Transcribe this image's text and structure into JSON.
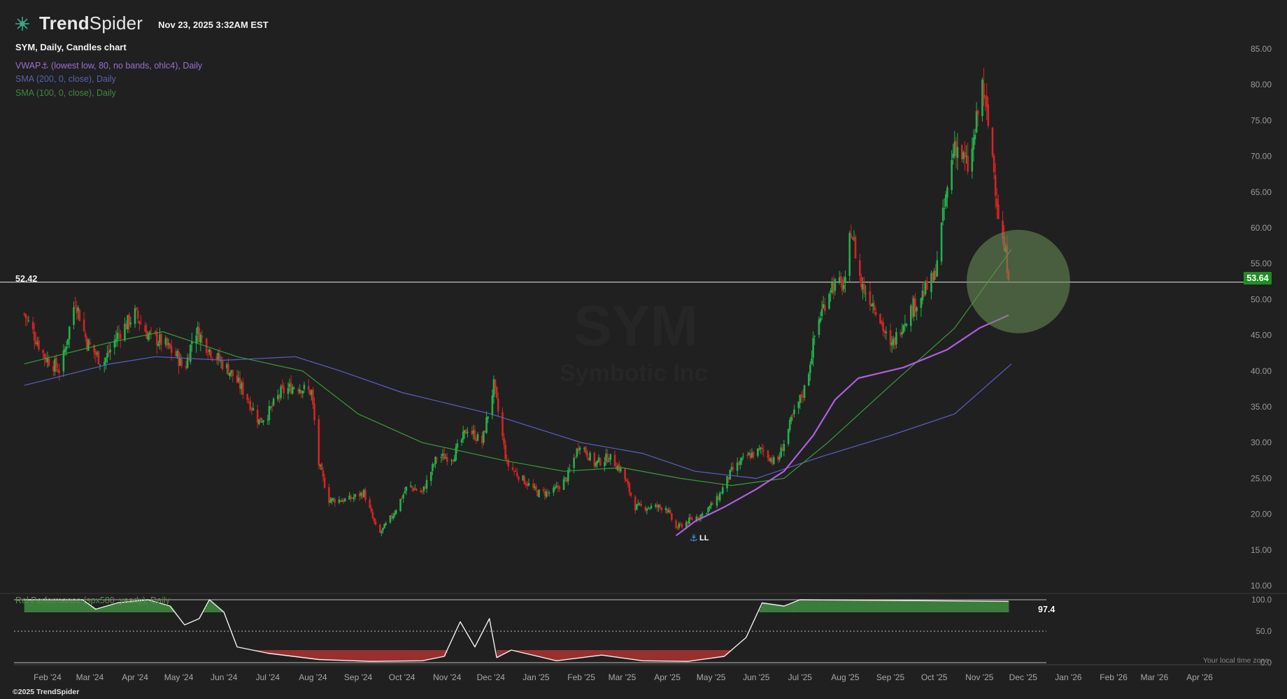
{
  "header": {
    "brand_prefix": "Trend",
    "brand_suffix": "Spider",
    "timestamp": "Nov 23, 2025 3:32AM EST",
    "chart_title": "SYM, Daily, Candles chart",
    "watermark_symbol": "SYM",
    "watermark_name": "Symbotic Inc"
  },
  "indicators": {
    "vwap": "VWAP⚓ (lowest low, 80, no bands, ohlc4), Daily",
    "sma200": "SMA (200, 0, close), Daily",
    "sma100": "SMA (100, 0, close), Daily",
    "relperf": "Rel Performance (spx500, yearly), Daily",
    "relperf_value": "97.4",
    "anchor_label": "LL"
  },
  "levels": {
    "horizontal_level": "52.42",
    "last_price": "53.64"
  },
  "footer": {
    "local_time": "Your local time zone",
    "copyright": "©2025 TrendSpider"
  },
  "colors": {
    "background": "#202020",
    "up": "#22b14c",
    "down": "#d32424",
    "vwap": "#b05ee0",
    "sma200": "#5b5fc7",
    "sma100": "#3a9a3a",
    "highlight_circle": "#6b8f5a"
  },
  "chart_data": {
    "type": "candlestick",
    "price_axis": {
      "ticks": [
        "85.00",
        "80.00",
        "75.00",
        "70.00",
        "65.00",
        "60.00",
        "55.00",
        "50.00",
        "45.00",
        "40.00",
        "35.00",
        "30.00",
        "25.00",
        "20.00",
        "15.00",
        "10.00"
      ],
      "range": [
        10,
        85
      ]
    },
    "x_axis": {
      "labels": [
        "Feb '24",
        "Mar '24",
        "Apr '24",
        "May '24",
        "Jun '24",
        "Jul '24",
        "Aug '24",
        "Sep '24",
        "Oct '24",
        "Nov '24",
        "Dec '24",
        "Jan '25",
        "Feb '25",
        "Mar '25",
        "Apr '25",
        "May '25",
        "Jun '25",
        "Jul '25",
        "Aug '25",
        "Sep '25",
        "Oct '25",
        "Nov '25",
        "Dec '25",
        "Jan '26",
        "Feb '26",
        "Mar '26",
        "Apr '26"
      ]
    },
    "price_path": [
      [
        "2024-01-16",
        48
      ],
      [
        "2024-01-30",
        42
      ],
      [
        "2024-02-10",
        40
      ],
      [
        "2024-02-20",
        50
      ],
      [
        "2024-02-28",
        44
      ],
      [
        "2024-03-10",
        41
      ],
      [
        "2024-03-20",
        45
      ],
      [
        "2024-04-01",
        48
      ],
      [
        "2024-04-10",
        45
      ],
      [
        "2024-04-20",
        44
      ],
      [
        "2024-04-30",
        42
      ],
      [
        "2024-05-05",
        40
      ],
      [
        "2024-05-12",
        46
      ],
      [
        "2024-05-22",
        43
      ],
      [
        "2024-06-05",
        40
      ],
      [
        "2024-06-15",
        37
      ],
      [
        "2024-06-25",
        33
      ],
      [
        "2024-07-01",
        34
      ],
      [
        "2024-07-10",
        37
      ],
      [
        "2024-07-20",
        38
      ],
      [
        "2024-07-31",
        37
      ],
      [
        "2024-08-05",
        27
      ],
      [
        "2024-08-12",
        22
      ],
      [
        "2024-08-25",
        22
      ],
      [
        "2024-09-05",
        23
      ],
      [
        "2024-09-15",
        17
      ],
      [
        "2024-09-25",
        20
      ],
      [
        "2024-10-05",
        24
      ],
      [
        "2024-10-15",
        23
      ],
      [
        "2024-10-25",
        28
      ],
      [
        "2024-11-05",
        28
      ],
      [
        "2024-11-15",
        32
      ],
      [
        "2024-11-25",
        30
      ],
      [
        "2024-12-03",
        38
      ],
      [
        "2024-12-12",
        27
      ],
      [
        "2024-12-22",
        25
      ],
      [
        "2025-01-02",
        23
      ],
      [
        "2025-01-12",
        23
      ],
      [
        "2025-01-22",
        25
      ],
      [
        "2025-01-31",
        30
      ],
      [
        "2025-02-10",
        27
      ],
      [
        "2025-02-20",
        28
      ],
      [
        "2025-03-01",
        26
      ],
      [
        "2025-03-10",
        21
      ],
      [
        "2025-03-20",
        21
      ],
      [
        "2025-03-31",
        21
      ],
      [
        "2025-04-07",
        18
      ],
      [
        "2025-04-15",
        19
      ],
      [
        "2025-04-25",
        20
      ],
      [
        "2025-05-05",
        22
      ],
      [
        "2025-05-15",
        26
      ],
      [
        "2025-05-25",
        28
      ],
      [
        "2025-06-05",
        29
      ],
      [
        "2025-06-15",
        27
      ],
      [
        "2025-06-25",
        33
      ],
      [
        "2025-07-05",
        38
      ],
      [
        "2025-07-12",
        46
      ],
      [
        "2025-07-22",
        52
      ],
      [
        "2025-08-01",
        52
      ],
      [
        "2025-08-05",
        60
      ],
      [
        "2025-08-12",
        52
      ],
      [
        "2025-08-22",
        49
      ],
      [
        "2025-09-01",
        43
      ],
      [
        "2025-09-10",
        47
      ],
      [
        "2025-09-20",
        50
      ],
      [
        "2025-10-01",
        53
      ],
      [
        "2025-10-06",
        60
      ],
      [
        "2025-10-15",
        72
      ],
      [
        "2025-10-25",
        68
      ],
      [
        "2025-11-03",
        80
      ],
      [
        "2025-11-10",
        70
      ],
      [
        "2025-11-15",
        60
      ],
      [
        "2025-11-21",
        54
      ]
    ],
    "sma200_path": [
      [
        "2024-01-16",
        38
      ],
      [
        "2024-03-15",
        41
      ],
      [
        "2024-04-15",
        42
      ],
      [
        "2024-06-01",
        41.5
      ],
      [
        "2024-07-20",
        42
      ],
      [
        "2024-08-20",
        40
      ],
      [
        "2024-10-01",
        37
      ],
      [
        "2024-12-01",
        34
      ],
      [
        "2025-02-01",
        30
      ],
      [
        "2025-03-15",
        28.5
      ],
      [
        "2025-04-20",
        26
      ],
      [
        "2025-06-01",
        25
      ],
      [
        "2025-07-15",
        28
      ],
      [
        "2025-09-01",
        31
      ],
      [
        "2025-10-15",
        34
      ],
      [
        "2025-11-23",
        41
      ]
    ],
    "sma100_path": [
      [
        "2024-01-16",
        41
      ],
      [
        "2024-03-15",
        44
      ],
      [
        "2024-04-20",
        45.5
      ],
      [
        "2024-06-10",
        42
      ],
      [
        "2024-07-25",
        40
      ],
      [
        "2024-09-01",
        34
      ],
      [
        "2024-10-15",
        30
      ],
      [
        "2024-12-10",
        27.5
      ],
      [
        "2025-01-20",
        26
      ],
      [
        "2025-03-01",
        26.5
      ],
      [
        "2025-04-10",
        25
      ],
      [
        "2025-05-15",
        24
      ],
      [
        "2025-06-20",
        25
      ],
      [
        "2025-07-20",
        30
      ],
      [
        "2025-09-01",
        38
      ],
      [
        "2025-10-15",
        46
      ],
      [
        "2025-11-23",
        57
      ]
    ],
    "vwap_path": [
      [
        "2025-04-07",
        17
      ],
      [
        "2025-04-20",
        19
      ],
      [
        "2025-05-10",
        21
      ],
      [
        "2025-06-01",
        23.5
      ],
      [
        "2025-06-20",
        26
      ],
      [
        "2025-07-10",
        31
      ],
      [
        "2025-07-25",
        36
      ],
      [
        "2025-08-10",
        39
      ],
      [
        "2025-09-10",
        40.5
      ],
      [
        "2025-10-10",
        43
      ],
      [
        "2025-11-01",
        46
      ],
      [
        "2025-11-21",
        47.8
      ]
    ],
    "relperf": {
      "ticks": [
        "100.0",
        "50.0",
        "0.0"
      ],
      "range": [
        0,
        100
      ],
      "path": [
        [
          "2024-01-16",
          100
        ],
        [
          "2024-02-25",
          100
        ],
        [
          "2024-03-05",
          85
        ],
        [
          "2024-03-20",
          95
        ],
        [
          "2024-04-10",
          100
        ],
        [
          "2024-04-25",
          90
        ],
        [
          "2024-05-05",
          60
        ],
        [
          "2024-05-15",
          70
        ],
        [
          "2024-05-22",
          100
        ],
        [
          "2024-06-01",
          80
        ],
        [
          "2024-06-10",
          25
        ],
        [
          "2024-07-01",
          15
        ],
        [
          "2024-08-05",
          5
        ],
        [
          "2024-09-10",
          2
        ],
        [
          "2024-10-15",
          3
        ],
        [
          "2024-10-30",
          10
        ],
        [
          "2024-11-10",
          65
        ],
        [
          "2024-11-20",
          25
        ],
        [
          "2024-11-30",
          70
        ],
        [
          "2024-12-05",
          8
        ],
        [
          "2024-12-15",
          20
        ],
        [
          "2025-01-15",
          3
        ],
        [
          "2025-02-15",
          12
        ],
        [
          "2025-03-15",
          3
        ],
        [
          "2025-04-15",
          2
        ],
        [
          "2025-05-10",
          10
        ],
        [
          "2025-05-25",
          40
        ],
        [
          "2025-06-05",
          95
        ],
        [
          "2025-06-20",
          90
        ],
        [
          "2025-07-01",
          100
        ],
        [
          "2025-11-21",
          97.4
        ]
      ]
    }
  }
}
